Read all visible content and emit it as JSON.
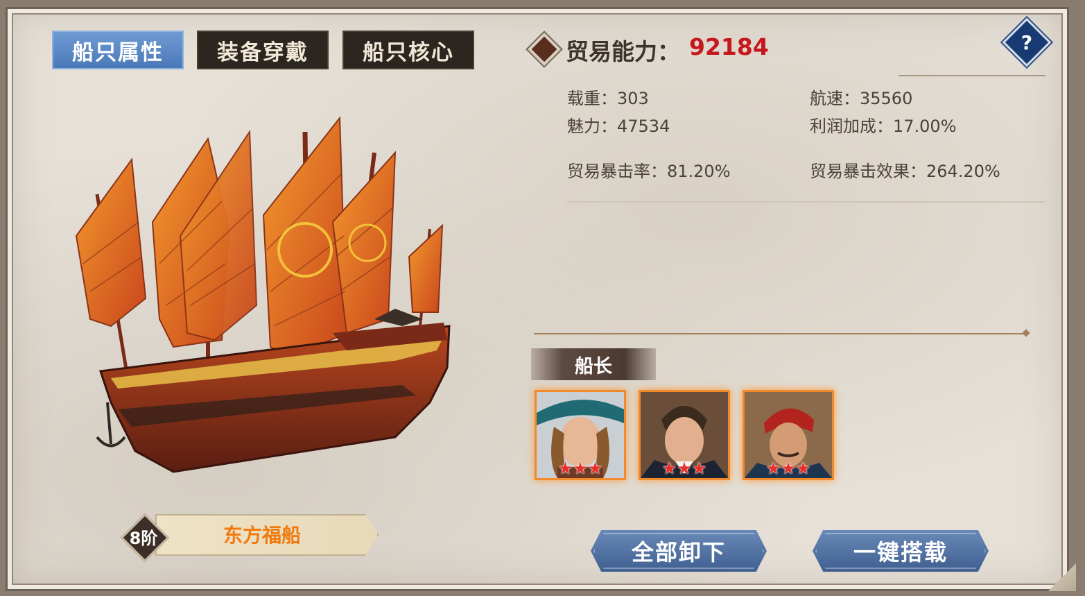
{
  "tabs": [
    {
      "label": "船只属性",
      "active": true
    },
    {
      "label": "装备穿戴",
      "active": false
    },
    {
      "label": "船只核心",
      "active": false
    }
  ],
  "trade_power": {
    "label": "贸易能力：",
    "value": "92184"
  },
  "help": {
    "label": "?"
  },
  "stats": {
    "load": "载重：303",
    "speed": "航速：35560",
    "charm": "魅力：47534",
    "profit_bonus": "利润加成：17.00%",
    "crit_rate": "贸易暴击率：81.20%",
    "crit_effect": "贸易暴击效果：264.20%"
  },
  "captain": {
    "label": "船长",
    "portraits": [
      {
        "name": "captain-1",
        "stars": "★★★"
      },
      {
        "name": "captain-2",
        "stars": "★★★"
      },
      {
        "name": "captain-3",
        "stars": "★★★"
      }
    ]
  },
  "ship": {
    "rank": "8阶",
    "name": "东方福船"
  },
  "buttons": {
    "unload_all": "全部卸下",
    "one_key_load": "一键搭载"
  },
  "colors": {
    "accent_red": "#c8161d",
    "tab_active": "#5b87c5",
    "ship_name": "#f07a10",
    "star": "#e8302a"
  }
}
